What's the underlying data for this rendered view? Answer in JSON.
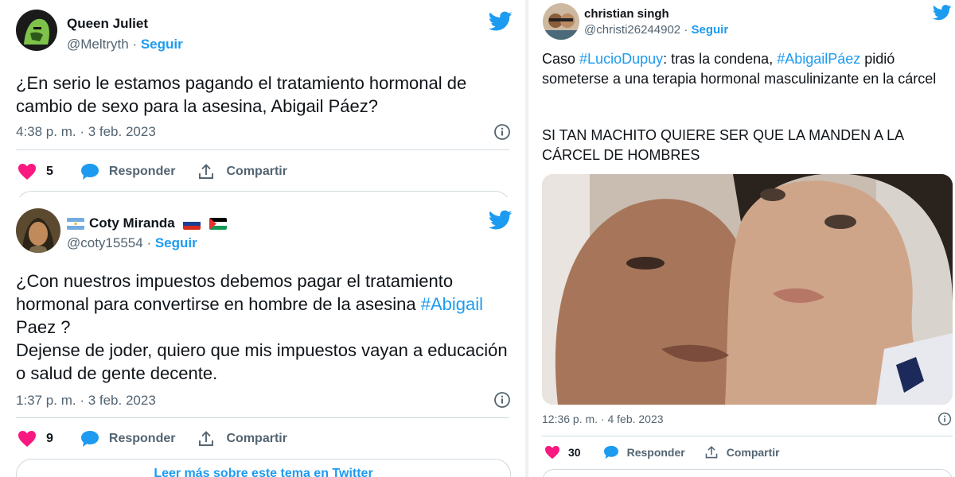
{
  "tweets": [
    {
      "name": "Queen Juliet",
      "handle": "@Meltryth",
      "follow": "Seguir",
      "text": "¿En serio le estamos pagando el tratamiento hormonal de cambio de sexo para la asesina, Abigail Páez?",
      "time": "4:38 p. m. · 3 feb. 2023",
      "likes": "5",
      "reply": "Responder",
      "share": "Compartir"
    },
    {
      "name": "Coty Miranda",
      "handle": "@coty15554",
      "follow": "Seguir",
      "text_p1": "¿Con nuestros impuestos debemos pagar el tratamiento hormonal para convertirse en hombre de la asesina",
      "hashtag": "#Abigail",
      "text_p2": " Paez ?",
      "text_p3": "Dejense de joder, quiero que mis impuestos vayan a educación o salud de gente decente.",
      "time": "1:37 p. m. · 3 feb. 2023",
      "likes": "9",
      "reply": "Responder",
      "share": "Compartir",
      "more": "Leer más sobre este tema en Twitter"
    },
    {
      "name": "christian singh",
      "handle": "@christi26244902",
      "follow": "Seguir",
      "text_pre": "Caso ",
      "hashtag1": "#LucioDupuy",
      "text_mid": ": tras la condena, ",
      "hashtag2": "#AbigailPáez",
      "text_post": " pidió someterse a una terapia hormonal masculinizante en la cárcel",
      "text_p2": "SI TAN MACHITO QUIERE SER QUE LA MANDEN A LA CÁRCEL DE HOMBRES",
      "time": "12:36 p. m. · 4 feb. 2023",
      "likes": "30",
      "reply": "Responder",
      "share": "Compartir"
    }
  ],
  "colors": {
    "accent": "#1d9bf0",
    "like": "#f91880",
    "muted": "#536471",
    "text": "#0f1419"
  },
  "icons": [
    "twitter-bird-icon",
    "heart-icon",
    "reply-bubble-icon",
    "share-icon",
    "info-icon"
  ]
}
